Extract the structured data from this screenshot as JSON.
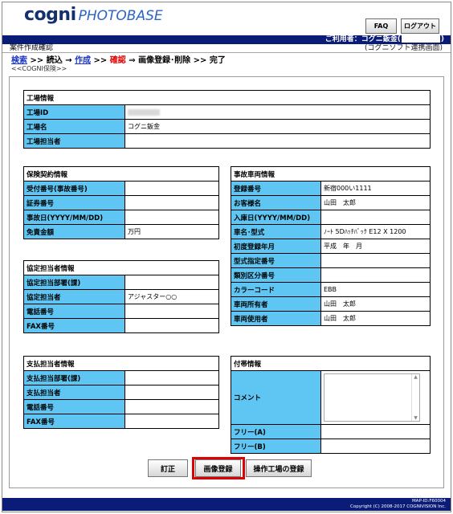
{
  "header": {
    "logo_cogni": "cogni",
    "logo_photobase": "PHOTOBASE",
    "faq_label": "FAQ",
    "logout_label": "ログアウト",
    "user_prefix": "ご利用者：コグニ鈑金(",
    "user_suffix": ")"
  },
  "title_bar": {
    "title": "案件作成確認",
    "right_note": "(コグニソフト連携画面)"
  },
  "breadcrumb": {
    "search": "検索",
    "sep1": " >> 読込 → ",
    "create": "作成",
    "sep2": " >> ",
    "confirm": "確認",
    "sep3": " ⇒ 画像登録･削除 >> 完了",
    "sub": "<<COGNI保険>>"
  },
  "factory": {
    "header": "工場情報",
    "rows": [
      {
        "label": "工場ID",
        "value": ""
      },
      {
        "label": "工場名",
        "value": "コグニ鈑金"
      },
      {
        "label": "工場担当者",
        "value": ""
      }
    ]
  },
  "insurance": {
    "header": "保険契約情報",
    "rows": [
      {
        "label": "受付番号(事故番号)",
        "value": ""
      },
      {
        "label": "証券番号",
        "value": ""
      },
      {
        "label": "事故日(YYYY/MM/DD)",
        "value": ""
      },
      {
        "label": "免責金額",
        "value": "万円"
      }
    ]
  },
  "vehicle": {
    "header": "事故車両情報",
    "rows": [
      {
        "label": "登録番号",
        "value": "新宿000い1111"
      },
      {
        "label": "お客様名",
        "value": "山田　太郎"
      },
      {
        "label": "入庫日(YYYY/MM/DD)",
        "value": ""
      },
      {
        "label": "車名･型式",
        "value": "ﾉｰﾄ 5Dﾊｯﾁﾊﾞｯｸ E12 X 1200"
      },
      {
        "label": "初度登録年月",
        "value": "平成　年　月"
      },
      {
        "label": "型式指定番号",
        "value": ""
      },
      {
        "label": "類別区分番号",
        "value": ""
      },
      {
        "label": "カラーコード",
        "value": "EBB"
      },
      {
        "label": "車両所有者",
        "value": "山田　太郎"
      },
      {
        "label": "車両使用者",
        "value": "山田　太郎"
      }
    ]
  },
  "adjuster": {
    "header": "協定担当者情報",
    "rows": [
      {
        "label": "協定担当部署(課)",
        "value": ""
      },
      {
        "label": "協定担当者",
        "value": "アジャスター○○"
      },
      {
        "label": "電話番号",
        "value": ""
      },
      {
        "label": "FAX番号",
        "value": ""
      }
    ]
  },
  "payment": {
    "header": "支払担当者情報",
    "rows": [
      {
        "label": "支払担当部署(課)",
        "value": ""
      },
      {
        "label": "支払担当者",
        "value": ""
      },
      {
        "label": "電話番号",
        "value": ""
      },
      {
        "label": "FAX番号",
        "value": ""
      }
    ]
  },
  "attached": {
    "header": "付帯情報",
    "rows": [
      {
        "label": "コメント",
        "value": ""
      },
      {
        "label": "フリー(A)",
        "value": ""
      },
      {
        "label": "フリー(B)",
        "value": ""
      }
    ]
  },
  "buttons": {
    "correct": "訂正",
    "image_register": "画像登録",
    "factory_register": "操作工場の登録"
  },
  "footer": {
    "map_id": "MAP-ID:F60004",
    "copyright": "Copyright (C) 2008-2017 COGNIVISION Inc."
  },
  "colors": {
    "navy": "#0b1b78",
    "label_blue": "#5fc5f2",
    "highlight_red": "#e00000"
  }
}
